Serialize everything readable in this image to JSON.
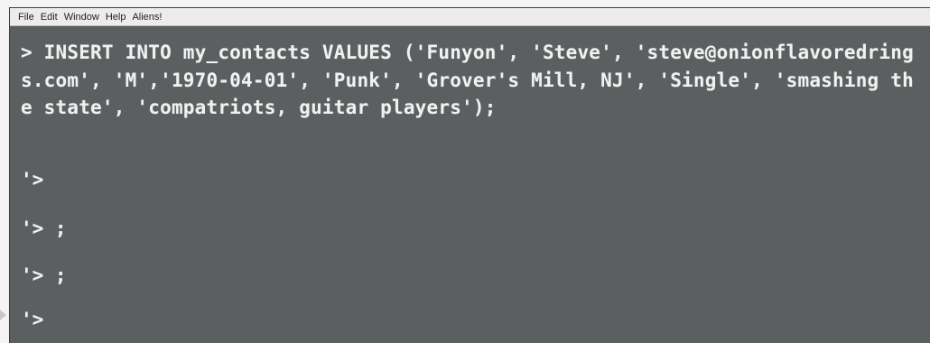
{
  "menubar": {
    "items": [
      "File",
      "Edit",
      "Window",
      "Help",
      "Aliens!"
    ]
  },
  "console": {
    "statement": "> INSERT INTO my_contacts VALUES ('Funyon', 'Steve', 'steve@onionflavoredrings.com', 'M','1970-04-01', 'Punk', 'Grover's Mill, NJ', 'Single', 'smashing the state', 'compatriots, guitar players');",
    "prompts": [
      "'>",
      "'> ;",
      "'> ;",
      "'>"
    ]
  },
  "colors": {
    "console_bg": "#5b5f60",
    "console_text": "#f1f1f1",
    "menubar_bg": "#ececec"
  }
}
